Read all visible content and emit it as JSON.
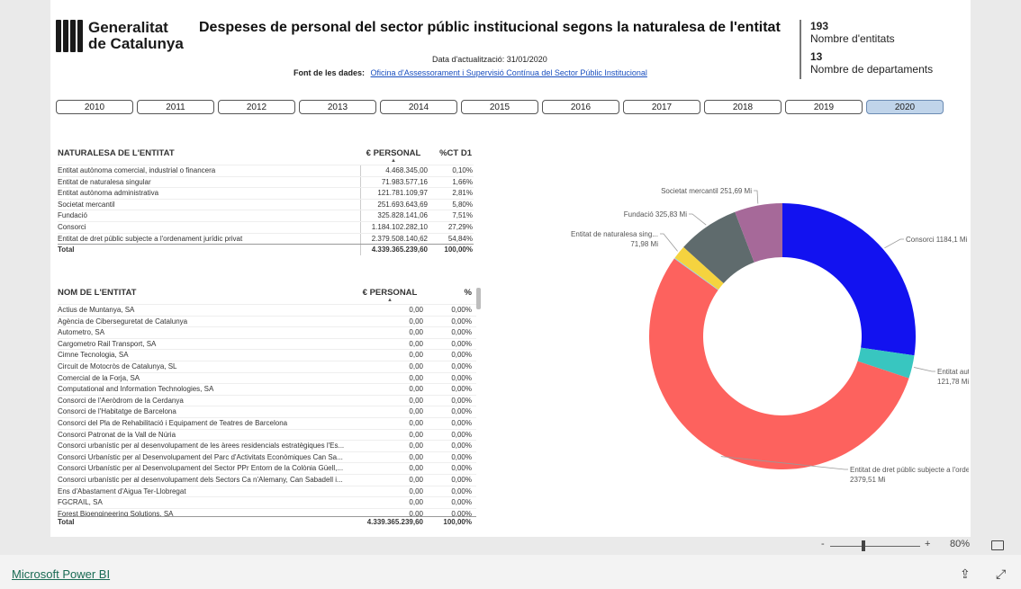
{
  "logo": {
    "line1": "Generalitat",
    "line2": "de Catalunya"
  },
  "title": "Despeses de personal del sector públic institucional segons la naturalesa de l'entitat",
  "update": "Data d'actualització: 31/01/2020",
  "source": {
    "label": "Font de les dades:",
    "link": "Oficina d'Assessorament i Supervisió Contínua del Sector Públic Institucional"
  },
  "kpis": [
    {
      "value": "193",
      "label": "Nombre d'entitats"
    },
    {
      "value": "13",
      "label": "Nombre de departaments"
    }
  ],
  "years": [
    "2010",
    "2011",
    "2012",
    "2013",
    "2014",
    "2015",
    "2016",
    "2017",
    "2018",
    "2019",
    "2020"
  ],
  "selected_year": "2020",
  "table1": {
    "headers": [
      "NATURALESA DE L'ENTITAT",
      "€ PERSONAL",
      "%CT D1"
    ],
    "rows": [
      [
        "Entitat autònoma comercial, industrial o financera",
        "4.468.345,00",
        "0,10%"
      ],
      [
        "Entitat de naturalesa singular",
        "71.983.577,16",
        "1,66%"
      ],
      [
        "Entitat autònoma administrativa",
        "121.781.109,97",
        "2,81%"
      ],
      [
        "Societat mercantil",
        "251.693.643,69",
        "5,80%"
      ],
      [
        "Fundació",
        "325.828.141,06",
        "7,51%"
      ],
      [
        "Consorci",
        "1.184.102.282,10",
        "27,29%"
      ],
      [
        "Entitat de dret públic subjecte a l'ordenament jurídic privat",
        "2.379.508.140,62",
        "54,84%"
      ]
    ],
    "total": [
      "Total",
      "4.339.365.239,60",
      "100,00%"
    ]
  },
  "table2": {
    "headers": [
      "NOM DE L'ENTITAT",
      "€ PERSONAL",
      "%"
    ],
    "rows": [
      [
        "Actius de Muntanya, SA",
        "0,00",
        "0,00%"
      ],
      [
        "Agència de Ciberseguretat de Catalunya",
        "0,00",
        "0,00%"
      ],
      [
        "Autometro, SA",
        "0,00",
        "0,00%"
      ],
      [
        "Cargometro Rail Transport, SA",
        "0,00",
        "0,00%"
      ],
      [
        "Cimne Tecnologia, SA",
        "0,00",
        "0,00%"
      ],
      [
        "Circuit de Motocròs de Catalunya, SL",
        "0,00",
        "0,00%"
      ],
      [
        "Comercial de la Forja, SA",
        "0,00",
        "0,00%"
      ],
      [
        "Computational and Information Technologies, SA",
        "0,00",
        "0,00%"
      ],
      [
        "Consorci de l'Aeròdrom de la Cerdanya",
        "0,00",
        "0,00%"
      ],
      [
        "Consorci de l'Habitatge de Barcelona",
        "0,00",
        "0,00%"
      ],
      [
        "Consorci del Pla de Rehabilitació i Equipament de Teatres de Barcelona",
        "0,00",
        "0,00%"
      ],
      [
        "Consorci Patronat de la Vall de Núria",
        "0,00",
        "0,00%"
      ],
      [
        "Consorci urbanístic per al desenvolupament de les àrees residencials estratègiques l'Es...",
        "0,00",
        "0,00%"
      ],
      [
        "Consorci Urbanístic per al Desenvolupament del Parc d'Activitats Econòmiques Can Sa...",
        "0,00",
        "0,00%"
      ],
      [
        "Consorci Urbanístic per al Desenvolupament del Sector PPr Entorn de la Colònia Güell,...",
        "0,00",
        "0,00%"
      ],
      [
        "Consorci urbanístic per al desenvolupament dels Sectors Ca n'Alemany, Can Sabadell i...",
        "0,00",
        "0,00%"
      ],
      [
        "Ens d'Abastament d'Aigua Ter-Llobregat",
        "0,00",
        "0,00%"
      ],
      [
        "FGCRAIL, SA",
        "0,00",
        "0,00%"
      ],
      [
        "Forest Bioengineering Solutions, SA",
        "0,00",
        "0,00%"
      ]
    ],
    "total": [
      "Total",
      "4.339.365.239,60",
      "100,00%"
    ]
  },
  "chart_data": {
    "type": "pie",
    "donut": true,
    "unit": "Mi",
    "slices": [
      {
        "label": "Consorci",
        "value": 1184.1,
        "display": "Consorci 1184,1 Mi",
        "color": "#1212f0"
      },
      {
        "label": "Entitat autònoma ...",
        "value": 121.78,
        "display": "121,78 Mi",
        "color": "#38c6c0"
      },
      {
        "label": "Entitat de dret públic subjecte a l'ordena...",
        "value": 2379.51,
        "display": "2379,51 Mi",
        "color": "#fd625e"
      },
      {
        "label": "Entitat autònoma comercial",
        "value": 4.47,
        "display": "",
        "color": "#8ad4eb"
      },
      {
        "label": "Entitat de naturalesa sing...",
        "value": 71.98,
        "display": "71,98 Mi",
        "color": "#f5d33f"
      },
      {
        "label": "Fundació",
        "value": 325.83,
        "display": "Fundació 325,83 Mi",
        "color": "#5f6b6d"
      },
      {
        "label": "Societat mercantil",
        "value": 251.69,
        "display": "Societat mercantil 251,69 Mi",
        "color": "#a66999"
      }
    ]
  },
  "zoom": {
    "minus": "-",
    "plus": "+",
    "level": "80%"
  },
  "footer": {
    "brand": "Microsoft Power BI"
  }
}
